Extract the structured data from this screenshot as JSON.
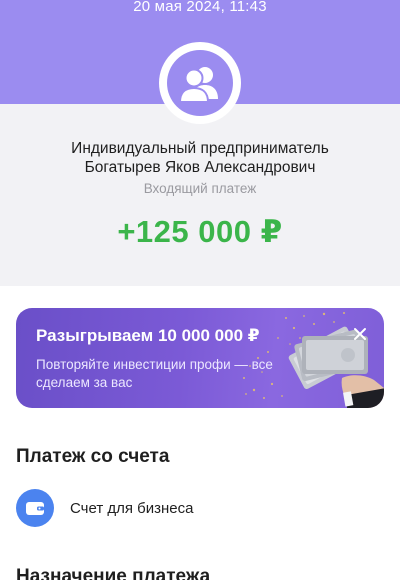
{
  "header": {
    "date": "20 мая 2024, 11:43"
  },
  "payment": {
    "payee_line1": "Индивидуальный предприниматель",
    "payee_line2": "Богатырев Яков Александрович",
    "type": "Входящий платеж",
    "amount": "+125 000 ₽",
    "avatar_icon": "people-icon",
    "amount_color": "#3bb54a"
  },
  "promo": {
    "title": "Разыгрываем 10 000 000 ₽",
    "subtitle": "Повторяйте инвестиции профи — все сделаем за вас",
    "close_icon": "close-icon"
  },
  "account_section": {
    "title": "Платеж со счета",
    "account_label": "Счет для бизнеса",
    "account_icon": "wallet-icon"
  },
  "purpose_section": {
    "title": "Назначение платежа"
  },
  "colors": {
    "header_bg": "#9b8cf0",
    "accent_blue": "#4b83ef",
    "promo_bg": "#7b5ad6"
  }
}
